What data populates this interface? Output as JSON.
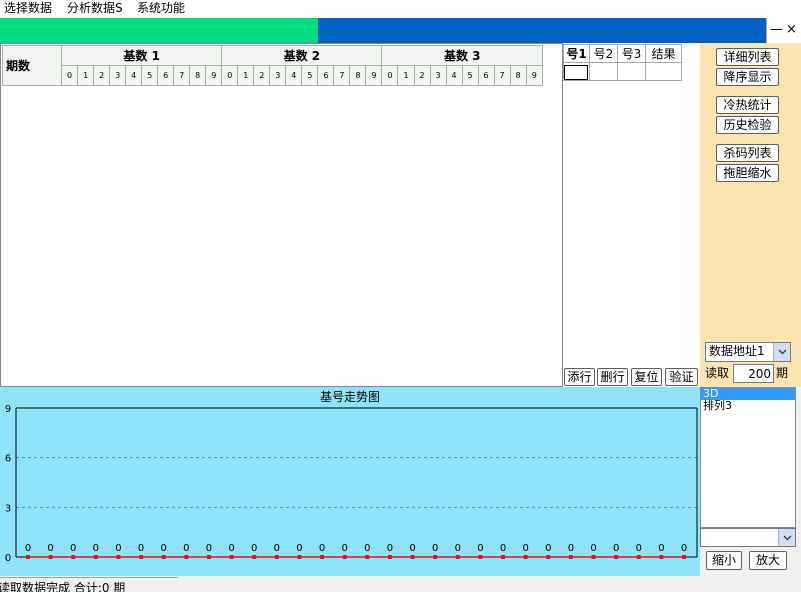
{
  "window": {
    "minimize_glyph": "—",
    "close_glyph": "×"
  },
  "menu": {
    "items": [
      "选择数据",
      "分析数据S",
      "系统功能"
    ]
  },
  "top_bar": {
    "fill_fraction": 0.415,
    "fill_color": "#00dc82",
    "track_color": "#0062c4"
  },
  "number_grid": {
    "period_header": "期数",
    "groups": [
      "基数 1",
      "基数 2",
      "基数 3"
    ],
    "digits": [
      "0",
      "1",
      "2",
      "3",
      "4",
      "5",
      "6",
      "7",
      "8",
      "9"
    ]
  },
  "code_table": {
    "headers": [
      "号1",
      "号2",
      "号3",
      "结果"
    ],
    "rows": [
      [
        "",
        "",
        "",
        ""
      ]
    ]
  },
  "row_buttons": [
    "添行",
    "删行",
    "复位",
    "验证"
  ],
  "side_panel": {
    "background": "#f9e4b2",
    "buttons": [
      [
        "详细列表",
        "降序显示"
      ],
      [
        "冷热统计",
        "历史检验"
      ],
      [
        "杀码列表",
        "拖胆缩水"
      ]
    ],
    "data_source": "数据地址1",
    "read_label": "读取",
    "read_count": "200",
    "period_unit": "期"
  },
  "chart_data": {
    "type": "line",
    "title": "基号走势图",
    "ylim": [
      0,
      9
    ],
    "yticks": [
      0,
      3,
      6,
      9
    ],
    "grid": true,
    "background": "#8ee3f8",
    "series": [
      {
        "color": "#ee1111",
        "data_labels": true,
        "values": [
          0,
          0,
          0,
          0,
          0,
          0,
          0,
          0,
          0,
          0,
          0,
          0,
          0,
          0,
          0,
          0,
          0,
          0,
          0,
          0,
          0,
          0,
          0,
          0,
          0,
          0,
          0,
          0,
          0,
          0
        ]
      }
    ]
  },
  "lottery_list": {
    "items": [
      "3D",
      "排列3"
    ],
    "selected": 0
  },
  "chart_combo": {
    "value": ""
  },
  "zoom": {
    "zoom_out": "缩小",
    "zoom_in": "放大"
  },
  "status": {
    "text": "读取数据完成 合计:0 期"
  }
}
